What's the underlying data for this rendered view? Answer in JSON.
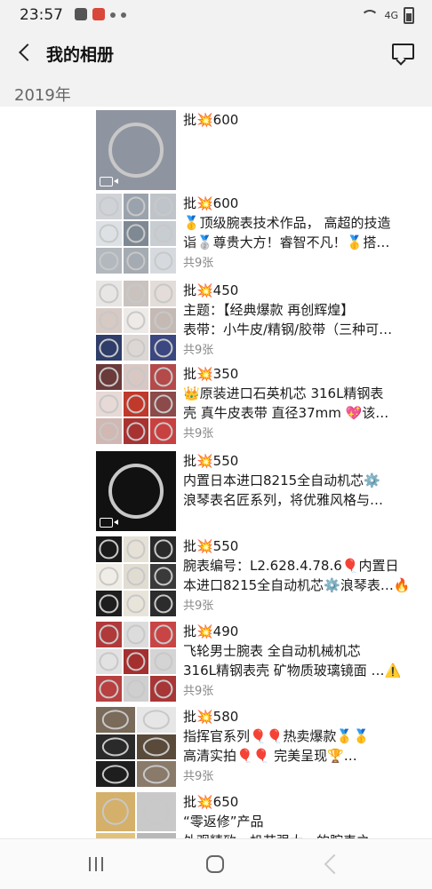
{
  "status_bar": {
    "time": "23:57",
    "network": "4G"
  },
  "header": {
    "title": "我的相册"
  },
  "year": "2019年",
  "posts": [
    {
      "lines": [
        "批💥600"
      ],
      "count": "",
      "photos": 1,
      "video": true,
      "palette": [
        "#8f95a0"
      ]
    },
    {
      "lines": [
        "批💥600",
        "🥇顶级腕表技术作品， 高超的技造",
        "诣🥈尊贵大方！睿智不凡！🥇搭…"
      ],
      "count": "共9张",
      "photos": 9,
      "video": false,
      "palette": [
        "#cfd3d8",
        "#9aa3ad",
        "#bfc4ca",
        "#dde1e5",
        "#7f8994",
        "#c8cdd2",
        "#b2b8be",
        "#a5abb2",
        "#d6dade"
      ]
    },
    {
      "lines": [
        "批💥450",
        "主题：【经典爆款 再创辉煌】",
        "表带：小牛皮/精钢/胶带（三种可…"
      ],
      "count": "共9张",
      "photos": 9,
      "video": false,
      "palette": [
        "#e8e6e4",
        "#c9c2be",
        "#e3dcd8",
        "#d7c9c4",
        "#edeae8",
        "#c5b9b4",
        "#2f3d6a",
        "#dcd7d4",
        "#3a4780"
      ]
    },
    {
      "lines": [
        "批💥350",
        "👑原装进口石英机芯  316L精钢表",
        "壳 真牛皮表带  直径37mm 💖该…"
      ],
      "count": "共9张",
      "photos": 9,
      "video": false,
      "palette": [
        "#6b3a3a",
        "#d9c7c3",
        "#b44a4a",
        "#e6d9d6",
        "#c0392b",
        "#8c4a4a",
        "#d1b8b3",
        "#a83232",
        "#c94040"
      ]
    },
    {
      "lines": [
        "批💥550",
        "内置日本进口8215全自动机芯⚙️",
        "浪琴表名匠系列，将优雅风格与…"
      ],
      "count": "",
      "photos": 1,
      "video": true,
      "palette": [
        "#111111"
      ]
    },
    {
      "lines": [
        "批💥550",
        "腕表编号：L2.628.4.78.6🎈内置日",
        "本进口8215全自动机芯⚙️浪琴表…🔥"
      ],
      "count": "共9张",
      "photos": 9,
      "video": false,
      "palette": [
        "#1a1a1a",
        "#e6e1d6",
        "#2a2a2a",
        "#f0ede6",
        "#e1dcd2",
        "#3a3a3a",
        "#1e1e1e",
        "#e9e4da",
        "#2c2c2c"
      ]
    },
    {
      "lines": [
        "批💥490",
        "飞轮男士腕表  全自动机械机芯",
        "316L精钢表壳  矿物质玻璃镜面  …⚠️"
      ],
      "count": "共9张",
      "photos": 9,
      "video": false,
      "palette": [
        "#b03a3a",
        "#dcdcdc",
        "#c94545",
        "#e2e2e2",
        "#a52f2f",
        "#d4d4d4",
        "#b84040",
        "#cfcfcf",
        "#a83636"
      ]
    },
    {
      "lines": [
        "批💥580",
        "指挥官系列🎈🎈热卖爆款🥇🥇",
        "高清实拍🎈🎈 完美呈现🏆…"
      ],
      "count": "共9张",
      "photos": 6,
      "video": false,
      "palette": [
        "#7a6a5a",
        "#e6e6e6",
        "#2a2a2a",
        "#5a4a3a",
        "#1e1e1e",
        "#8a7a6a"
      ]
    },
    {
      "lines": [
        "批💥650",
        "“零返修”产品",
        "外观精致，机芯强大，的腕表之…"
      ],
      "count": "",
      "photos": 4,
      "video": false,
      "palette": [
        "#d4b06a",
        "#c9c9c9",
        "#e0c27a",
        "#b8b8b8"
      ]
    }
  ],
  "post_tops": [
    4,
    98,
    196,
    290,
    388,
    484,
    580,
    676,
    772
  ]
}
